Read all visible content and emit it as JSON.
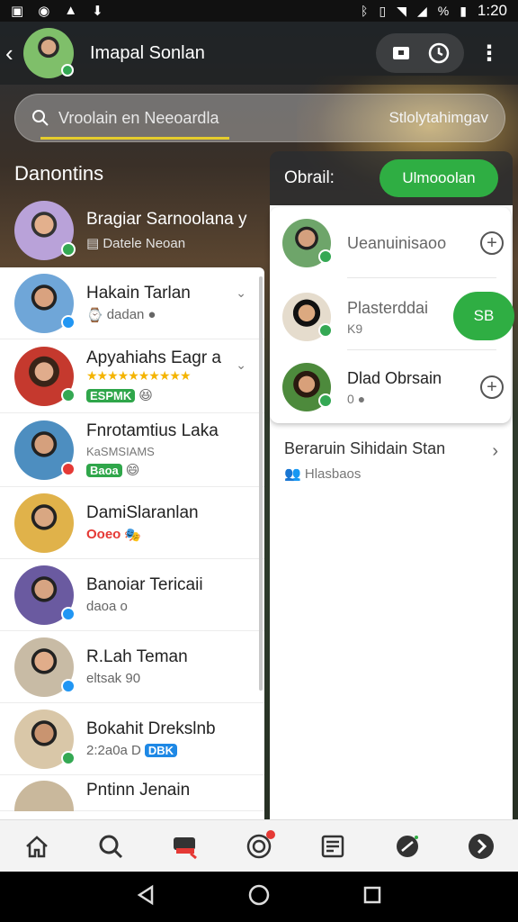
{
  "status_bar": {
    "time": "1:20",
    "battery_text": "%"
  },
  "header": {
    "title": "Imapal Sonlan"
  },
  "search": {
    "placeholder": "Vroolain en Neeoardla",
    "right_text": "Stlolytahimgav"
  },
  "left": {
    "section_title": "Danontins",
    "top_contact": {
      "name": "Bragiar Sarnoolana y",
      "sub": "Datele Neoan"
    },
    "contacts": [
      {
        "name": "Hakain Tarlan",
        "sub": "dadan",
        "badge": "blue"
      },
      {
        "name": "Apyahiahs Eagr a",
        "stars": "★★★★★★★★★★",
        "tag": "ESPMK",
        "badge": "green"
      },
      {
        "name": "Fnrotamtius Laka",
        "sub": "KaSMSIAMS",
        "tag": "Baoa",
        "badge": "red"
      },
      {
        "name": "DamiSlaranlan",
        "tag": "Ooeo",
        "badge": "none"
      },
      {
        "name": "Banoiar Tericaii",
        "sub": "daoa o",
        "badge": "blue"
      },
      {
        "name": "R.Lah Teman",
        "sub": "eltsak 90",
        "badge": "blue"
      },
      {
        "name": "Bokahit Drekslnb",
        "sub": "2:2a0a D",
        "tag": "DBK",
        "badge": "green"
      },
      {
        "name": "Pntinn Jenain",
        "sub": "",
        "badge": "none"
      }
    ]
  },
  "right": {
    "head_label": "Obrail:",
    "head_button": "Ulmooolan",
    "suggestions": [
      {
        "name": "Ueanuinisaoo",
        "sub": "",
        "action": "add"
      },
      {
        "name": "Plasterddai",
        "sub": "K9",
        "action": "pill",
        "pill_label": "SB"
      },
      {
        "name": "Dlad Obrsain",
        "sub": "0",
        "action": "add"
      }
    ],
    "item": {
      "name": "Beraruin Sihidain Stan",
      "sub": "Hlasbaos"
    }
  },
  "colors": {
    "accent_green": "#2fae43",
    "search_underline": "#e5cc2c"
  }
}
